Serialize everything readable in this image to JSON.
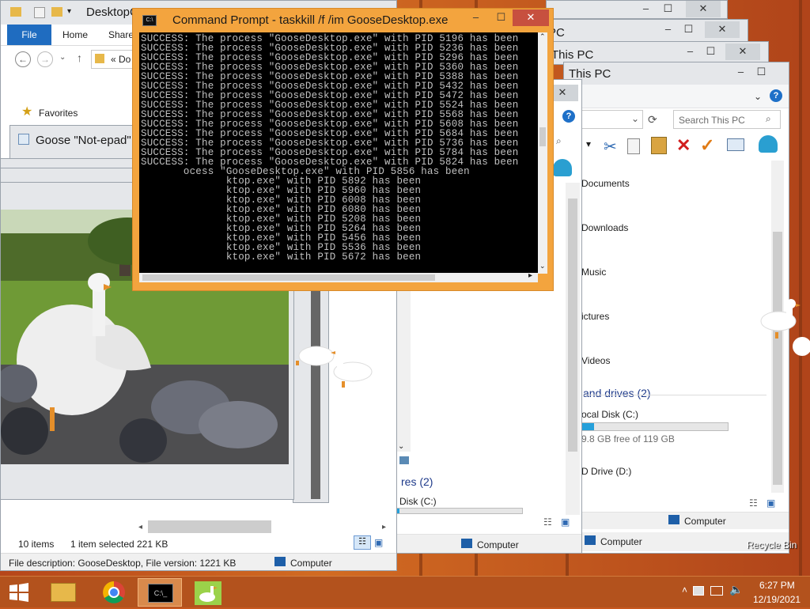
{
  "desktop": {
    "recycle_bin": "Recycle Bin"
  },
  "explorer_left": {
    "title": "DesktopC",
    "tabs": [
      "File",
      "Home",
      "Share"
    ],
    "address": "« Do",
    "favorites": "Favorites",
    "status_items": "10 items",
    "status_selected": "1 item selected",
    "status_size": "221 KB",
    "details": "File description: GooseDesktop, File version: 1.",
    "details_size": "221 KB",
    "computer": "Computer"
  },
  "notepad": {
    "title": "Goose \"Not-epad\""
  },
  "explorer_mid": {
    "drives_heading": "res (2)",
    "disk": "Disk (C:)",
    "computer": "Computer"
  },
  "explorer_right": {
    "titles": [
      "PC",
      "This PC",
      "This PC"
    ],
    "search_placeholder": "Search This PC",
    "folders": [
      "Documents",
      "Downloads",
      "Music",
      "ictures",
      "Videos"
    ],
    "drives_heading": "and drives (2)",
    "local_disk": "ocal Disk (C:)",
    "free_space": "9.8 GB free of 119 GB",
    "disk_fill": 0.08,
    "cd_drive": "D Drive (D:)",
    "computer": "Computer",
    "computer2": "Computer"
  },
  "cmd": {
    "title": "Command Prompt - taskkill  /f /im GooseDesktop.exe",
    "lines": [
      "SUCCESS: The process \"GooseDesktop.exe\" with PID 5196 has been",
      "SUCCESS: The process \"GooseDesktop.exe\" with PID 5236 has been",
      "SUCCESS: The process \"GooseDesktop.exe\" with PID 5296 has been",
      "SUCCESS: The process \"GooseDesktop.exe\" with PID 5360 has been",
      "SUCCESS: The process \"GooseDesktop.exe\" with PID 5388 has been",
      "SUCCESS: The process \"GooseDesktop.exe\" with PID 5432 has been",
      "SUCCESS: The process \"GooseDesktop.exe\" with PID 5472 has been",
      "SUCCESS: The process \"GooseDesktop.exe\" with PID 5524 has been",
      "SUCCESS: The process \"GooseDesktop.exe\" with PID 5568 has been",
      "SUCCESS: The process \"GooseDesktop.exe\" with PID 5608 has been",
      "SUCCESS: The process \"GooseDesktop.exe\" with PID 5684 has been",
      "SUCCESS: The process \"GooseDesktop.exe\" with PID 5736 has been",
      "SUCCESS: The process \"GooseDesktop.exe\" with PID 5784 has been",
      "SUCCESS: The process \"GooseDesktop.exe\" with PID 5824 has been",
      "       ocess \"GooseDesktop.exe\" with PID 5856 has been",
      "              ktop.exe\" with PID 5892 has been",
      "              ktop.exe\" with PID 5960 has been",
      "              ktop.exe\" with PID 6008 has been",
      "              ktop.exe\" with PID 6080 has been",
      "              ktop.exe\" with PID 5208 has been",
      "              ktop.exe\" with PID 5264 has been",
      "              ktop.exe\" with PID 5456 has been",
      "              ktop.exe\" with PID 5536 has been",
      "              ktop.exe\" with PID 5672 has been"
    ]
  },
  "taskbar": {
    "time": "6:27 PM",
    "date": "12/19/2021"
  }
}
